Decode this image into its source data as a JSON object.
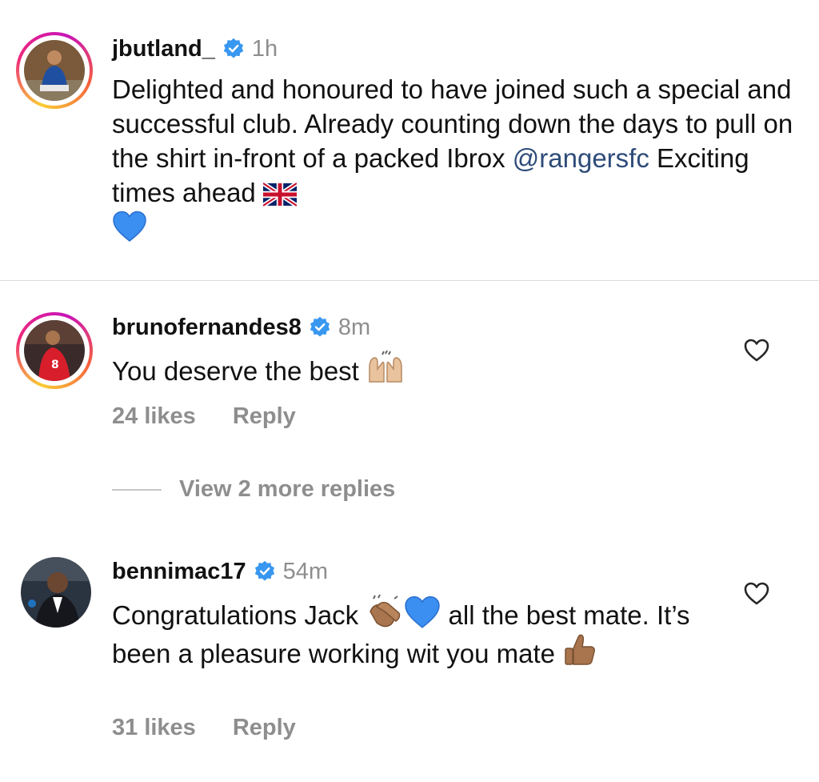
{
  "post": {
    "username": "jbutland_",
    "time": "1h",
    "text_before_mention": "Delighted and honoured to have joined such a special and successful club. Already counting down the days to pull on the shirt in-front of a packed Ibrox ",
    "mention": "@rangersfc",
    "text_after_mention": " Exciting times ahead ",
    "emojis": [
      "uk-flag",
      "blue-heart"
    ]
  },
  "comments": [
    {
      "username": "brunofernandes8",
      "time": "8m",
      "text": "You deserve the best ",
      "emojis": [
        "raising-hands"
      ],
      "likes": "24 likes",
      "reply_label": "Reply",
      "view_replies": "View 2 more replies"
    },
    {
      "username": "bennimac17",
      "time": "54m",
      "text_part1": "Congratulations Jack ",
      "text_part2": " all the best mate. It’s been a pleasure working wit you mate ",
      "emojis": [
        "clapping-hands",
        "blue-heart",
        "thumbs-up"
      ],
      "likes": "31 likes",
      "reply_label": "Reply"
    }
  ],
  "icons": {
    "verified": "verified-badge-icon",
    "like": "heart-outline-icon"
  },
  "colors": {
    "verified_blue": "#3897f0",
    "mention": "#2e4c7a",
    "muted": "#8e8e8e",
    "divider": "#dbdbdb",
    "heart_emoji": "#3b8ff0"
  }
}
